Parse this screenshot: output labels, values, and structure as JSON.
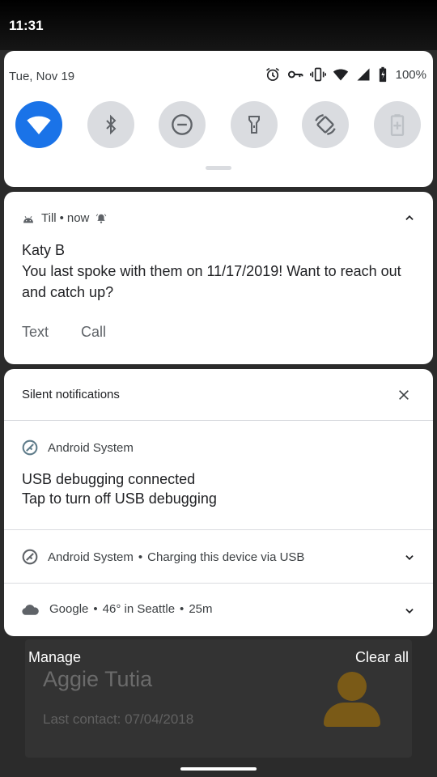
{
  "status_bar": {
    "time": "11:31"
  },
  "quick_settings": {
    "date": "Tue, Nov 19",
    "battery": "100%",
    "tiles": [
      {
        "name": "wifi",
        "active": true
      },
      {
        "name": "bluetooth",
        "active": false
      },
      {
        "name": "do-not-disturb",
        "active": false
      },
      {
        "name": "flashlight",
        "active": false
      },
      {
        "name": "auto-rotate",
        "active": false
      },
      {
        "name": "battery-saver",
        "active": false
      }
    ],
    "status_icons": [
      "alarm-icon",
      "vpn-key-icon",
      "vibrate-icon",
      "wifi-icon",
      "cell-signal-icon",
      "battery-icon"
    ]
  },
  "till_notification": {
    "app": "Till",
    "sep": "•",
    "time": "now",
    "title": "Katy B",
    "body": "You last spoke with them on 11/17/2019! Want to reach out and catch up?",
    "actions": [
      "Text",
      "Call"
    ]
  },
  "silent": {
    "header": "Silent notifications",
    "usb": {
      "app": "Android System",
      "title": "USB debugging connected",
      "body": "Tap to turn off USB debugging"
    },
    "charging": {
      "app": "Android System",
      "sep": "•",
      "text": "Charging this device via USB"
    },
    "weather": {
      "app": "Google",
      "sep1": "•",
      "temp": "46° in Seattle",
      "sep2": "•",
      "age": "25m"
    }
  },
  "footer": {
    "manage": "Manage",
    "clear_all": "Clear all"
  },
  "background": {
    "name": "Aggie Tutia",
    "last_contact": "Last contact: 07/04/2018"
  },
  "colors": {
    "accent": "#1a73e8",
    "tile_inactive": "#dadce0",
    "avatar": "#7a5a17"
  }
}
